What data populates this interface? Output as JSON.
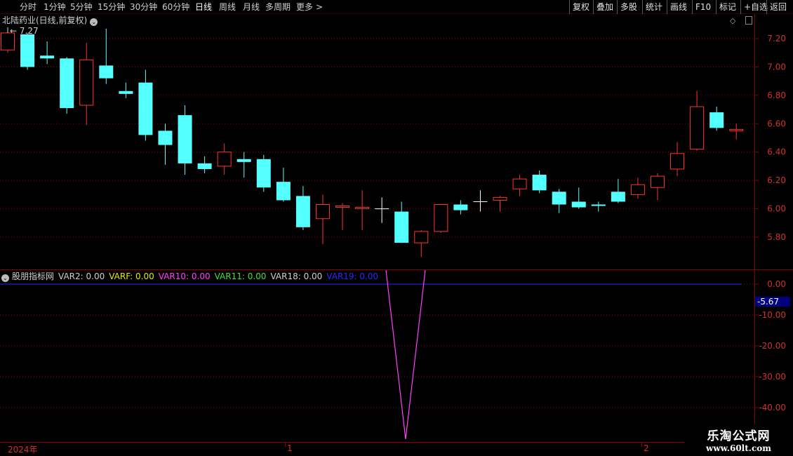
{
  "toolbar": {
    "periods": [
      "分时",
      "1分钟",
      "5分钟",
      "15分钟",
      "30分钟",
      "60分钟",
      "日线",
      "周线",
      "月线",
      "多周期",
      "更多"
    ],
    "active_period": "日线",
    "more_chevron": ">",
    "buttons": [
      "复权",
      "叠加",
      "多股",
      "统计",
      "画线",
      "F10",
      "标记",
      "+自选",
      "返回"
    ]
  },
  "chart_title": "北陆药业(日线,前复权)",
  "price_labels": {
    "high": "7.27",
    "low": "5.66"
  },
  "indicator": {
    "name": "股朋指标网",
    "vars": [
      {
        "label": "VAR2: 0.00",
        "color": "#d0d0d0"
      },
      {
        "label": "VARF: 0.00",
        "color": "#e8e800"
      },
      {
        "label": "VAR10: 0.00",
        "color": "#ff40ff"
      },
      {
        "label": "VAR11: 0.00",
        "color": "#40e040"
      },
      {
        "label": "VAR18: 0.00",
        "color": "#d0d0d0"
      },
      {
        "label": "VAR19: 0.00",
        "color": "#2828ff"
      }
    ],
    "current_value": "-5.67"
  },
  "date_axis": {
    "year": "2024年",
    "month1": "1",
    "month2": "2"
  },
  "watermark": {
    "line1": "乐淘公式网",
    "line2": "www.60lt.com"
  },
  "colors": {
    "up": "#ff3232",
    "down": "#54ffff",
    "grid": "#8b0000",
    "var10": "#ff40ff",
    "var19": "#2828ff"
  },
  "chart_data": [
    {
      "type": "candlestick",
      "title": "北陆药业(日线,前复权)",
      "y_ticks": [
        7.2,
        7.0,
        6.8,
        6.6,
        6.4,
        6.2,
        6.0,
        5.8
      ],
      "y_tick_labels": [
        "7.20",
        "7.00",
        "6.80",
        "6.60",
        "6.40",
        "6.20",
        "6.00",
        "5.80"
      ],
      "ylim": [
        5.62,
        7.4
      ],
      "candles": [
        {
          "o": 7.12,
          "h": 7.27,
          "l": 7.1,
          "c": 7.24
        },
        {
          "o": 7.23,
          "h": 7.24,
          "l": 6.98,
          "c": 7.0
        },
        {
          "o": 7.08,
          "h": 7.18,
          "l": 7.02,
          "c": 7.06
        },
        {
          "o": 7.06,
          "h": 7.07,
          "l": 6.67,
          "c": 6.71
        },
        {
          "o": 6.73,
          "h": 7.17,
          "l": 6.59,
          "c": 7.05
        },
        {
          "o": 7.01,
          "h": 7.27,
          "l": 6.88,
          "c": 6.92
        },
        {
          "o": 6.83,
          "h": 6.89,
          "l": 6.78,
          "c": 6.81
        },
        {
          "o": 6.89,
          "h": 6.98,
          "l": 6.48,
          "c": 6.52
        },
        {
          "o": 6.55,
          "h": 6.6,
          "l": 6.31,
          "c": 6.45
        },
        {
          "o": 6.66,
          "h": 6.73,
          "l": 6.24,
          "c": 6.32
        },
        {
          "o": 6.32,
          "h": 6.37,
          "l": 6.25,
          "c": 6.28
        },
        {
          "o": 6.3,
          "h": 6.46,
          "l": 6.24,
          "c": 6.4
        },
        {
          "o": 6.35,
          "h": 6.4,
          "l": 6.22,
          "c": 6.33
        },
        {
          "o": 6.35,
          "h": 6.38,
          "l": 6.12,
          "c": 6.15
        },
        {
          "o": 6.19,
          "h": 6.29,
          "l": 6.05,
          "c": 6.06
        },
        {
          "o": 6.09,
          "h": 6.16,
          "l": 5.85,
          "c": 5.87
        },
        {
          "o": 5.93,
          "h": 6.1,
          "l": 5.75,
          "c": 6.03
        },
        {
          "o": 6.01,
          "h": 6.04,
          "l": 5.85,
          "c": 6.02
        },
        {
          "o": 6.0,
          "h": 6.13,
          "l": 5.85,
          "c": 6.01
        },
        {
          "o": 6.0,
          "h": 6.08,
          "l": 5.9,
          "c": 6.0
        },
        {
          "o": 5.98,
          "h": 6.05,
          "l": 5.76,
          "c": 5.76
        },
        {
          "o": 5.76,
          "h": 5.85,
          "l": 5.66,
          "c": 5.84
        },
        {
          "o": 5.84,
          "h": 6.03,
          "l": 5.83,
          "c": 6.03
        },
        {
          "o": 6.03,
          "h": 6.06,
          "l": 5.96,
          "c": 5.99
        },
        {
          "o": 6.05,
          "h": 6.13,
          "l": 5.98,
          "c": 6.05
        },
        {
          "o": 6.06,
          "h": 6.09,
          "l": 5.98,
          "c": 6.08
        },
        {
          "o": 6.14,
          "h": 6.24,
          "l": 6.09,
          "c": 6.21
        },
        {
          "o": 6.24,
          "h": 6.27,
          "l": 6.11,
          "c": 6.13
        },
        {
          "o": 6.12,
          "h": 6.14,
          "l": 5.97,
          "c": 6.03
        },
        {
          "o": 6.05,
          "h": 6.15,
          "l": 6.0,
          "c": 6.01
        },
        {
          "o": 6.03,
          "h": 6.05,
          "l": 5.98,
          "c": 6.02
        },
        {
          "o": 6.12,
          "h": 6.21,
          "l": 6.04,
          "c": 6.05
        },
        {
          "o": 6.1,
          "h": 6.22,
          "l": 6.07,
          "c": 6.17
        },
        {
          "o": 6.15,
          "h": 6.25,
          "l": 6.06,
          "c": 6.23
        },
        {
          "o": 6.28,
          "h": 6.47,
          "l": 6.23,
          "c": 6.39
        },
        {
          "o": 6.42,
          "h": 6.83,
          "l": 6.41,
          "c": 6.72
        },
        {
          "o": 6.68,
          "h": 6.72,
          "l": 6.55,
          "c": 6.57
        },
        {
          "o": 6.55,
          "h": 6.6,
          "l": 6.49,
          "c": 6.56
        }
      ]
    },
    {
      "type": "line",
      "title": "股朋指标网",
      "y_ticks": [
        0,
        -10,
        -20,
        -30,
        -40
      ],
      "y_tick_labels": [
        "0.00",
        "-10.00",
        "-20.00",
        "-30.00",
        "-40.00"
      ],
      "ylim": [
        -50.5,
        2.0
      ],
      "series": [
        {
          "name": "VAR10",
          "color": "#ff40ff",
          "values_by_index": {
            "18": 0,
            "19": 0,
            "20": -50,
            "21": 0,
            "22": 0
          }
        },
        {
          "name": "VAR19",
          "color": "#2828ff",
          "constant": 0
        }
      ]
    }
  ]
}
